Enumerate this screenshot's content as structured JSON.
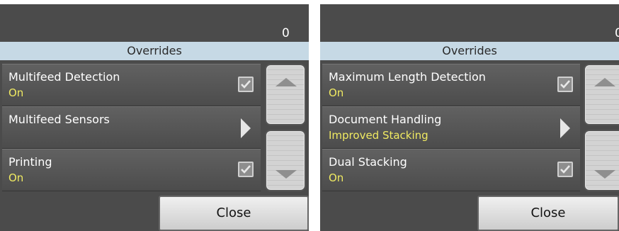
{
  "screens": [
    {
      "counter": "0",
      "header": "Overrides",
      "rows": [
        {
          "title": "Multifeed Detection",
          "value": "On",
          "control": "checkbox-icon"
        },
        {
          "title": "Multifeed Sensors",
          "value": "",
          "control": "chevron-right-icon"
        },
        {
          "title": "Printing",
          "value": "On",
          "control": "checkbox-icon"
        }
      ],
      "close_label": "Close"
    },
    {
      "counter": "0",
      "header": "Overrides",
      "rows": [
        {
          "title": "Maximum Length Detection",
          "value": "On",
          "control": "checkbox-icon"
        },
        {
          "title": "Document Handling",
          "value": "Improved Stacking",
          "control": "chevron-right-icon"
        },
        {
          "title": "Dual Stacking",
          "value": "On",
          "control": "checkbox-icon"
        }
      ],
      "close_label": "Close"
    }
  ],
  "colors": {
    "background": "#4b4b4b",
    "header": "#c6d9e5",
    "value_text": "#f0ea62"
  }
}
